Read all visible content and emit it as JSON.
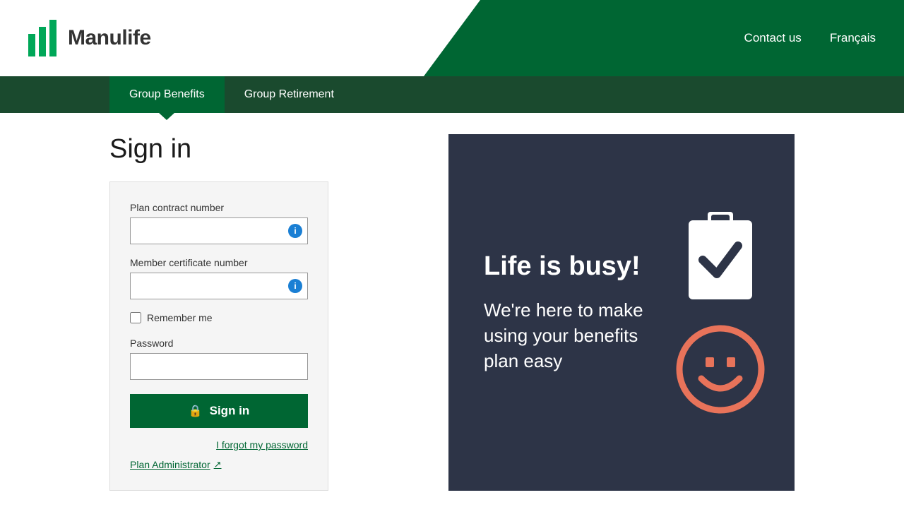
{
  "header": {
    "logo_text": "Manulife",
    "nav_links": [
      {
        "label": "Contact us",
        "id": "contact-us"
      },
      {
        "label": "Français",
        "id": "francais"
      }
    ]
  },
  "nav": {
    "items": [
      {
        "label": "Group Benefits",
        "active": true,
        "id": "group-benefits"
      },
      {
        "label": "Group Retirement",
        "active": false,
        "id": "group-retirement"
      }
    ]
  },
  "signin": {
    "title": "Sign in",
    "plan_contract_label": "Plan contract number",
    "plan_contract_placeholder": "",
    "member_cert_label": "Member certificate number",
    "member_cert_placeholder": "",
    "remember_me_label": "Remember me",
    "password_label": "Password",
    "sign_in_button": "Sign in",
    "forgot_password_link": "I forgot my password",
    "admin_link": "Plan Administrator",
    "admin_icon": "↗"
  },
  "promo": {
    "headline": "Life is busy!",
    "subtext": "We're here to make using your benefits plan easy"
  }
}
